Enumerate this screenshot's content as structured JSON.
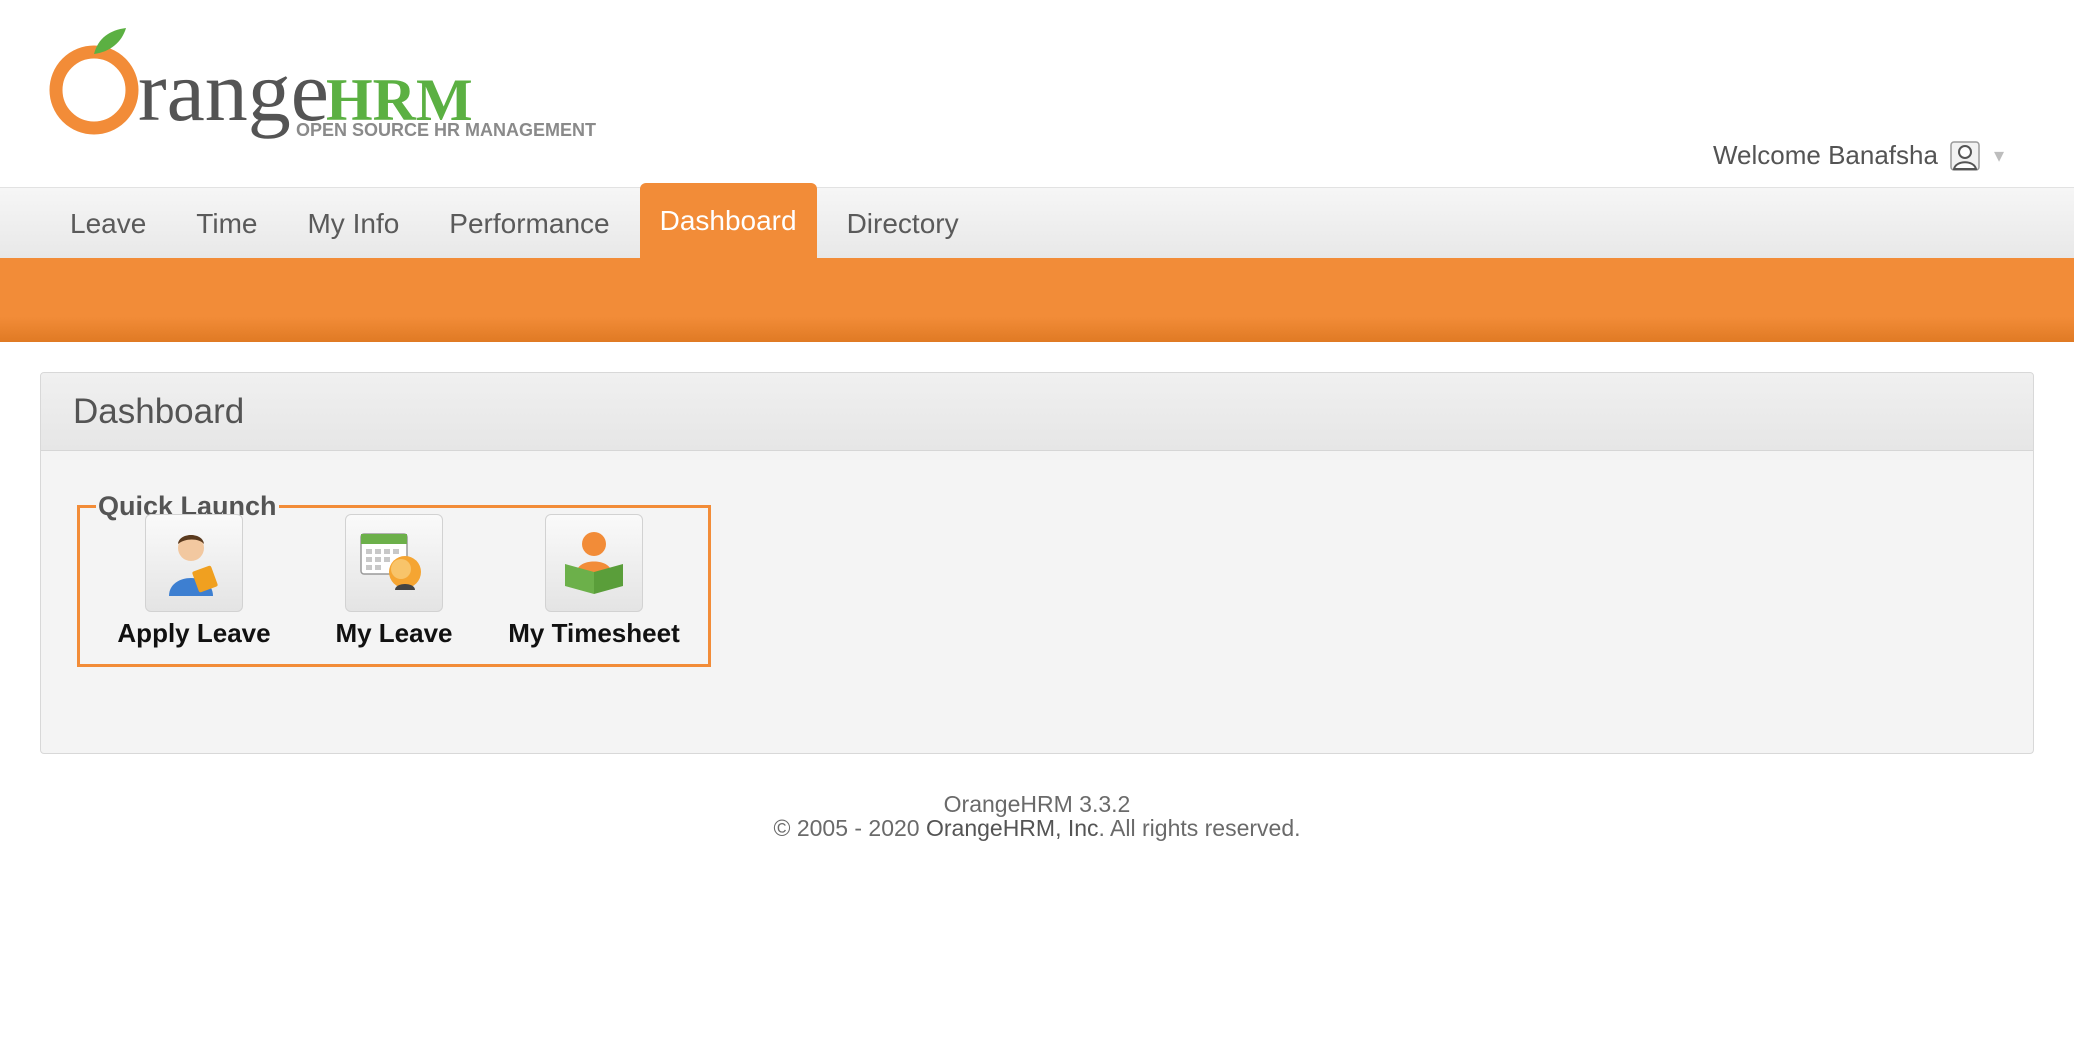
{
  "logo": {
    "word_orange": "Orange",
    "word_hrm": "HRM",
    "tagline": "OPEN SOURCE HR MANAGEMENT",
    "icon": "orange-fruit-logo"
  },
  "header": {
    "welcome_text": "Welcome Banafsha",
    "user_icon": "user-avatar-icon",
    "caret": "▾"
  },
  "menu": {
    "items": [
      {
        "label": "Leave"
      },
      {
        "label": "Time"
      },
      {
        "label": "My Info"
      },
      {
        "label": "Performance"
      },
      {
        "label": "Dashboard",
        "active": true
      },
      {
        "label": "Directory"
      }
    ]
  },
  "dashboard": {
    "title": "Dashboard",
    "quick_launch": {
      "legend": "Quick Launch",
      "items": [
        {
          "label": "Apply Leave",
          "icon": "apply-leave-icon"
        },
        {
          "label": "My Leave",
          "icon": "my-leave-calendar-icon"
        },
        {
          "label": "My Timesheet",
          "icon": "timesheet-reader-icon"
        }
      ]
    }
  },
  "footer": {
    "version": "OrangeHRM 3.3.2",
    "copyright_prefix": "© 2005 - 2020 ",
    "company_link": "OrangeHRM, Inc",
    "copyright_suffix": ". All rights reserved."
  },
  "colors": {
    "accent": "#f28c38",
    "green": "#5bb042",
    "text": "#545454"
  }
}
